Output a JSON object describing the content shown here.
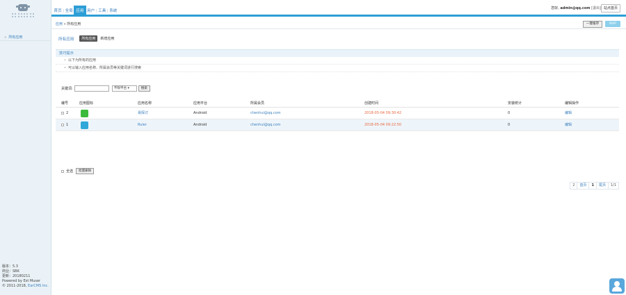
{
  "sidebar": {
    "nav_item": "所有应用",
    "footer": {
      "version": "版本：5.3",
      "edition": "商业：SBK",
      "update": "更新：20180211",
      "powered_by": "Powered by Est Muser",
      "copyright_prefix": "© 2011-2018,",
      "copyright_link": "EarCMS Inc."
    }
  },
  "header": {
    "nav": [
      "首页",
      "全局",
      "应用",
      "用户",
      "工具",
      "系统"
    ],
    "active_index": 2,
    "user_greeting": "您好,",
    "user_email": "admin@qq.com",
    "logout_label": "[退出]",
    "site_button": "站点首页"
  },
  "breadcrumb": {
    "root": "应用",
    "separator": "»",
    "current": "所有应用",
    "cache_button": "一键缓存",
    "map_button": "MAP"
  },
  "main": {
    "section_title": "所有应用",
    "tabs": [
      {
        "label": "所有应用",
        "active": true
      },
      {
        "label": "新增应用",
        "active": false
      }
    ],
    "tips": {
      "title": "技巧提示",
      "lines": [
        "以下为所有的应用",
        "可以输入应用名称、所属会员等关键词进行搜索"
      ]
    },
    "search": {
      "keyword_label": "关键词:",
      "keyword_value": "",
      "platform_select": "不限平台",
      "search_button": "搜索"
    },
    "table": {
      "headers": [
        "编号",
        "应用图标",
        "应用名称",
        "应用平台",
        "所属会员",
        "创建时间",
        "安装统计",
        "编辑操作"
      ],
      "rows": [
        {
          "id": "2",
          "name": "易探讨",
          "platform": "Android",
          "member": "chenhui@qq.com",
          "time": "2018-05-04 09:30:42",
          "installs": "0",
          "action": "编辑",
          "icon_color": "#3bbb3b"
        },
        {
          "id": "1",
          "name": "Ruler",
          "platform": "Android",
          "member": "chenhui@qq.com",
          "time": "2018-05-04 09:22:50",
          "installs": "0",
          "action": "编辑",
          "icon_color": "#2fa7d9"
        }
      ]
    },
    "bulk": {
      "select_all": "全选",
      "delete_button": "批量删除"
    },
    "pager": [
      "2",
      "首页",
      "1",
      "尾页",
      "1/1"
    ]
  }
}
